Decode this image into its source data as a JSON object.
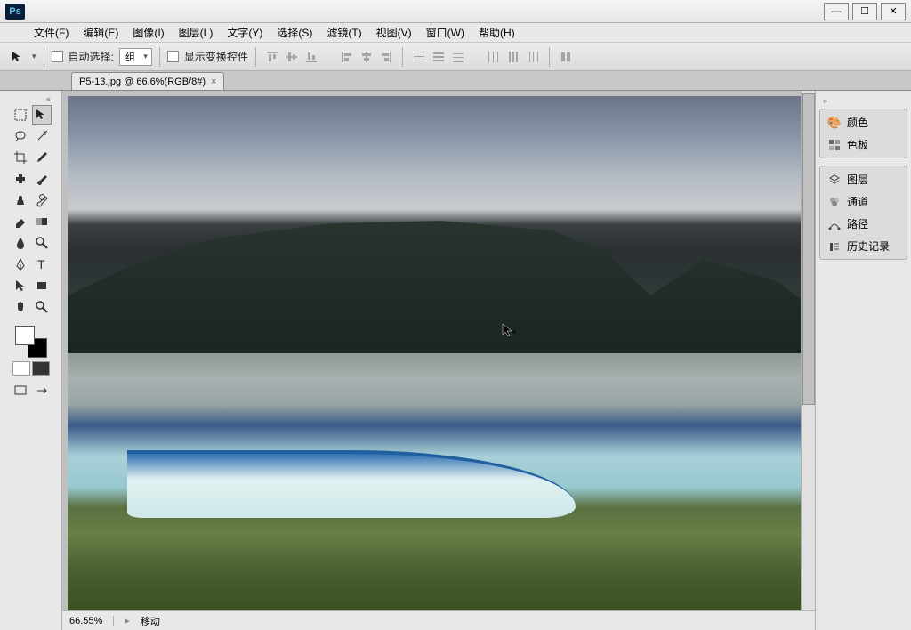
{
  "app": {
    "logo": "Ps"
  },
  "window_controls": {
    "min": "—",
    "max": "☐",
    "close": "✕"
  },
  "menu": {
    "file": "文件(F)",
    "edit": "编辑(E)",
    "image": "图像(I)",
    "layer": "图层(L)",
    "type": "文字(Y)",
    "select": "选择(S)",
    "filter": "滤镜(T)",
    "view": "视图(V)",
    "window": "窗口(W)",
    "help": "帮助(H)"
  },
  "options": {
    "auto_select_label": "自动选择:",
    "auto_select_value": "组",
    "show_transform_label": "显示变换控件"
  },
  "document": {
    "tab_title": "P5-13.jpg @ 66.6%(RGB/8#)",
    "close_glyph": "×"
  },
  "status": {
    "zoom": "66.55%",
    "tool": "移动"
  },
  "panels": {
    "color": "颜色",
    "swatches": "色板",
    "layers": "图层",
    "channels": "通道",
    "paths": "路径",
    "history": "历史记录"
  },
  "colors": {
    "foreground": "#ffffff",
    "background": "#000000"
  }
}
